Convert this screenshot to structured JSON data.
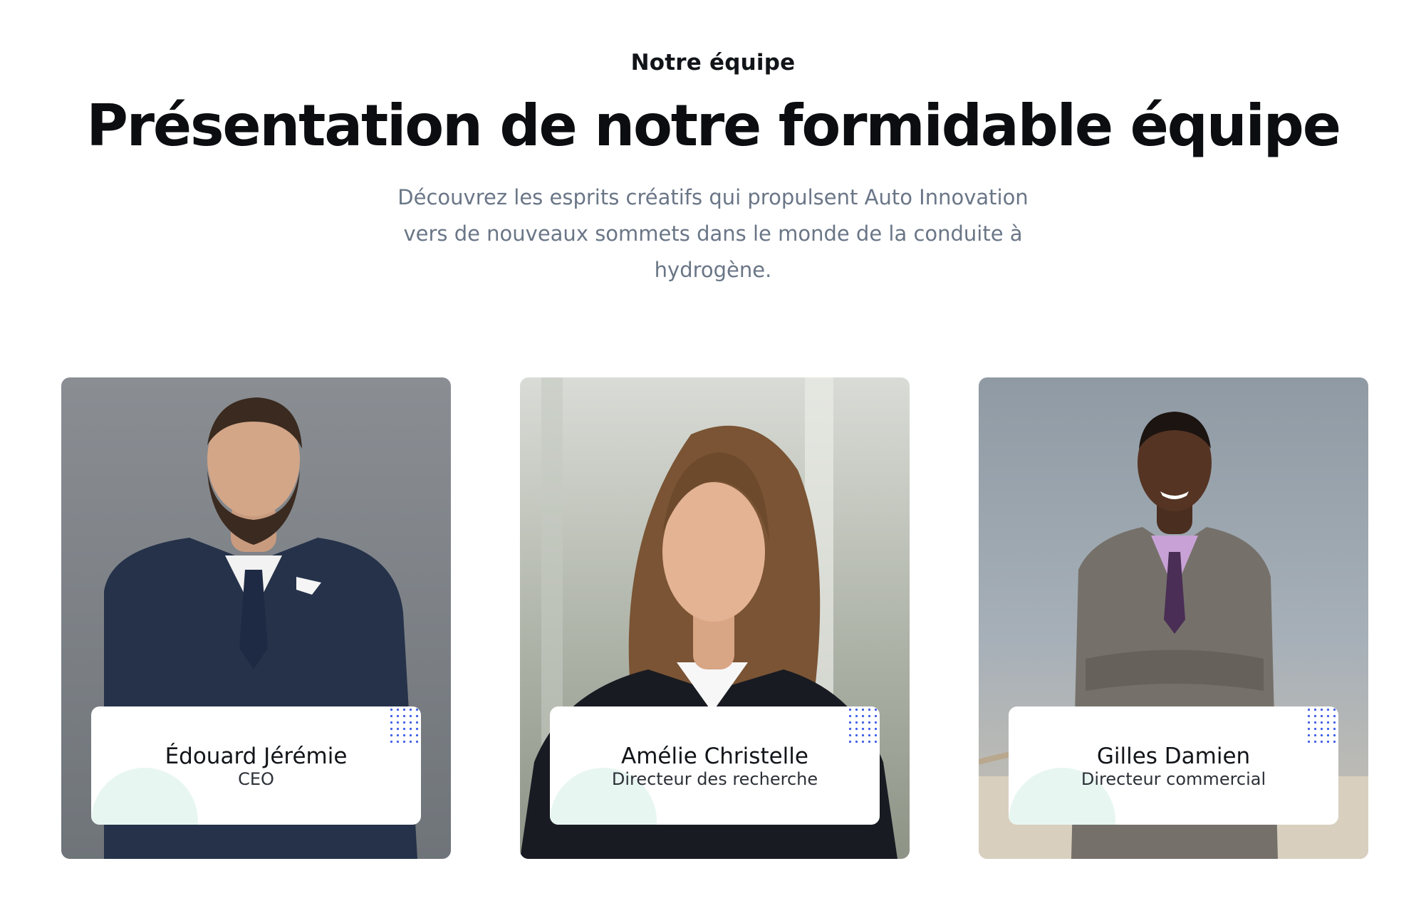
{
  "section": {
    "eyebrow": "Notre équipe",
    "title": "Présentation de notre formidable équipe",
    "intro_lines": [
      "Découvrez les esprits créatifs qui propulsent Auto Innovation",
      "vers de nouveaux sommets dans le monde de la conduite à",
      "hydrogène."
    ]
  },
  "team": [
    {
      "name": "Édouard Jérémie",
      "role": "CEO"
    },
    {
      "name": "Amélie Christelle",
      "role": "Directeur des recherche"
    },
    {
      "name": "Gilles Damien",
      "role": "Directeur commercial"
    }
  ],
  "colors": {
    "heading": "#0b0d10",
    "intro_text": "#6a7687",
    "dot_accent": "#3f5ee6",
    "panel_blob": "#e8f6f1"
  }
}
